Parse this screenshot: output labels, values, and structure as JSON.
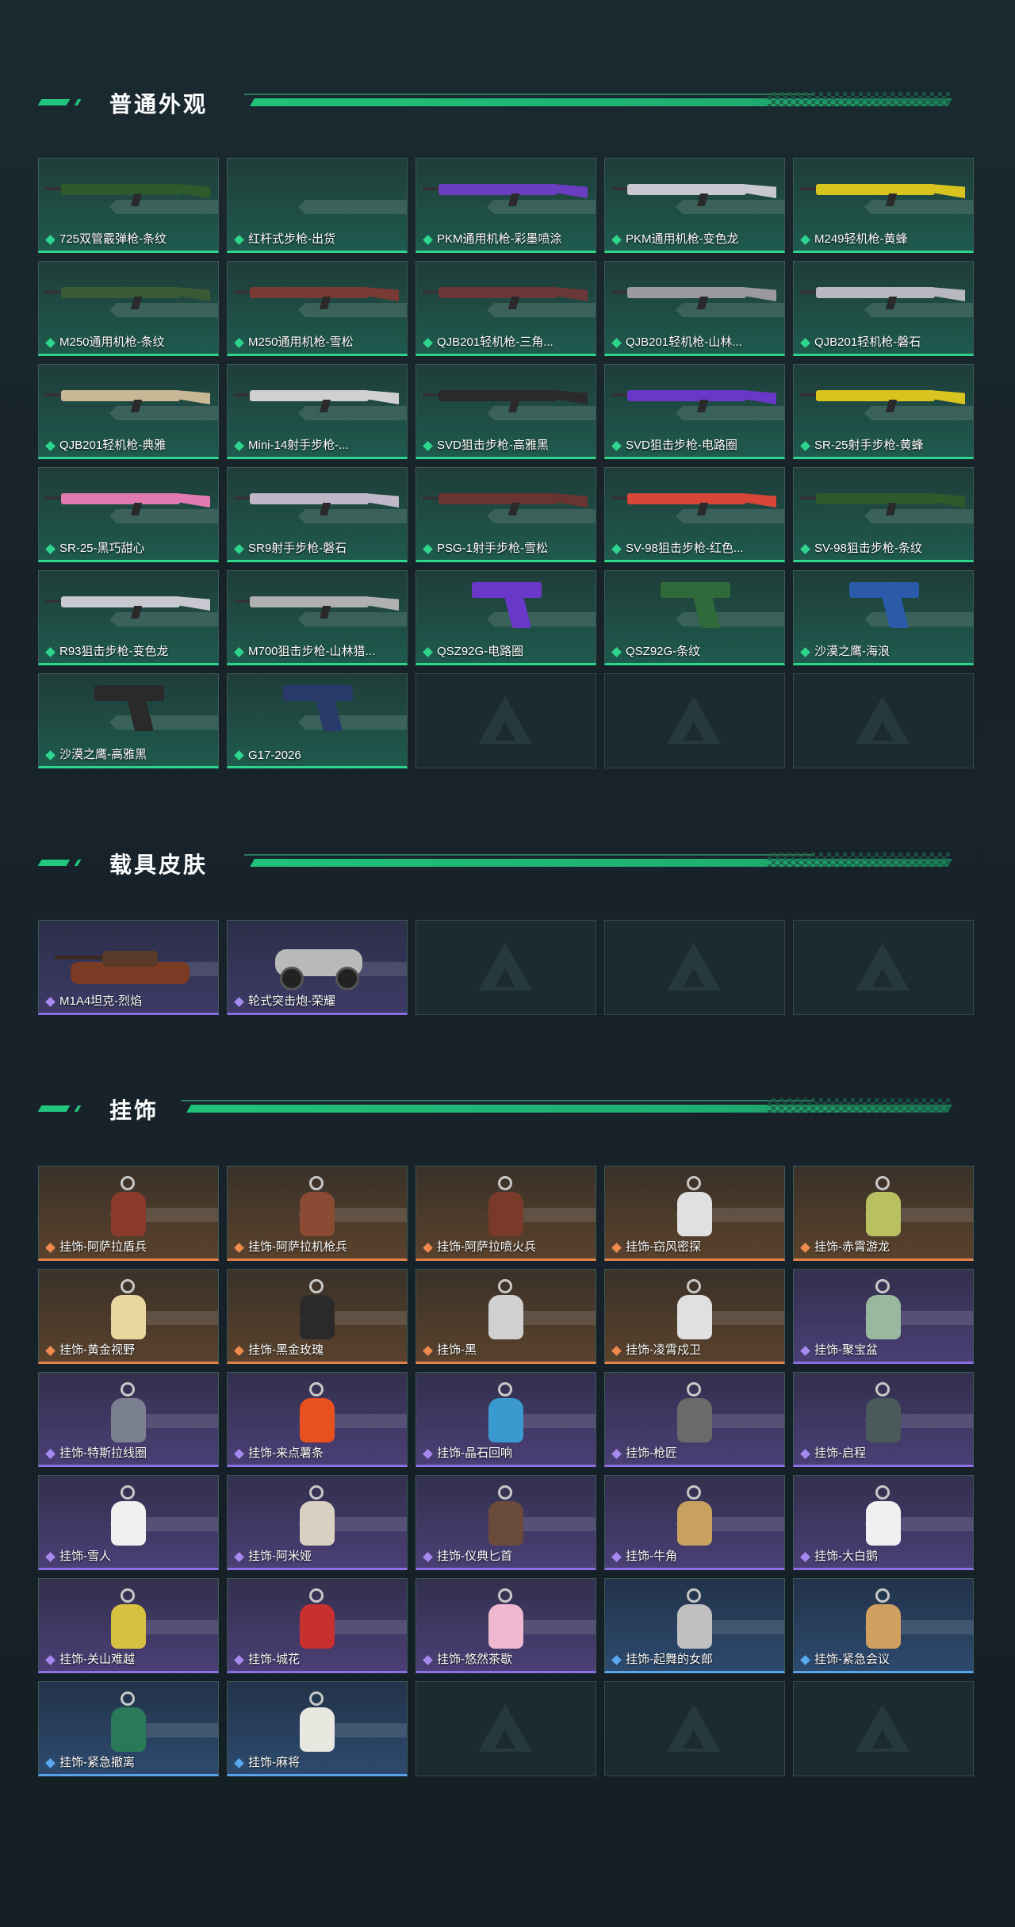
{
  "sections": [
    {
      "title": "普通外观",
      "items": [
        {
          "name": "725双管霰弹枪-条纹",
          "rarity": "weapon",
          "art": "gun",
          "color": "#2f5a2c"
        },
        {
          "name": "红杆式步枪-出货",
          "rarity": "weapon",
          "art": "none",
          "color": ""
        },
        {
          "name": "PKM通用机枪-彩墨喷涂",
          "rarity": "weapon",
          "art": "gun",
          "color": "#6a3ec0"
        },
        {
          "name": "PKM通用机枪-变色龙",
          "rarity": "weapon",
          "art": "gun",
          "color": "#c8c8d0"
        },
        {
          "name": "M249轻机枪-黄蜂",
          "rarity": "weapon",
          "art": "gun",
          "color": "#d8c41e"
        },
        {
          "name": "M250通用机枪-条纹",
          "rarity": "weapon",
          "art": "gun",
          "color": "#3a5a36"
        },
        {
          "name": "M250通用机枪-雪松",
          "rarity": "weapon",
          "art": "gun",
          "color": "#7a3a34"
        },
        {
          "name": "QJB201轻机枪-三角...",
          "rarity": "weapon",
          "art": "gun",
          "color": "#6a3838"
        },
        {
          "name": "QJB201轻机枪-山林...",
          "rarity": "weapon",
          "art": "gun",
          "color": "#9a9aa0"
        },
        {
          "name": "QJB201轻机枪-磐石",
          "rarity": "weapon",
          "art": "gun",
          "color": "#b8b8c0"
        },
        {
          "name": "QJB201轻机枪-典雅",
          "rarity": "weapon",
          "art": "gun",
          "color": "#c9b896"
        },
        {
          "name": "Mini-14射手步枪-...",
          "rarity": "weapon",
          "art": "gun",
          "color": "#d0d0d0"
        },
        {
          "name": "SVD狙击步枪-高雅黑",
          "rarity": "weapon",
          "art": "gun",
          "color": "#2a2a2a"
        },
        {
          "name": "SVD狙击步枪-电路圈",
          "rarity": "weapon",
          "art": "gun",
          "color": "#6a38c8"
        },
        {
          "name": "SR-25射手步枪-黄蜂",
          "rarity": "weapon",
          "art": "gun",
          "color": "#d8c41e"
        },
        {
          "name": "SR-25-黑巧甜心",
          "rarity": "weapon",
          "art": "gun",
          "color": "#e07ab0"
        },
        {
          "name": "SR9射手步枪-磐石",
          "rarity": "weapon",
          "art": "gun",
          "color": "#c0b8c8"
        },
        {
          "name": "PSG-1射手步枪-雪松",
          "rarity": "weapon",
          "art": "gun",
          "color": "#6a3432"
        },
        {
          "name": "SV-98狙击步枪-红色...",
          "rarity": "weapon",
          "art": "gun",
          "color": "#d8463a"
        },
        {
          "name": "SV-98狙击步枪-条纹",
          "rarity": "weapon",
          "art": "gun",
          "color": "#2f5a2c"
        },
        {
          "name": "R93狙击步枪-变色龙",
          "rarity": "weapon",
          "art": "gun",
          "color": "#c8c8d0"
        },
        {
          "name": "M700狙击步枪-山林猎...",
          "rarity": "weapon",
          "art": "gun",
          "color": "#b0b0b0"
        },
        {
          "name": "QSZ92G-电路圈",
          "rarity": "weapon",
          "art": "pistol",
          "color": "#6a38c8"
        },
        {
          "name": "QSZ92G-条纹",
          "rarity": "weapon",
          "art": "pistol",
          "color": "#2f6a3a"
        },
        {
          "name": "沙漠之鹰-海浪",
          "rarity": "weapon",
          "art": "pistol",
          "color": "#2a5aa8"
        },
        {
          "name": "沙漠之鹰-高雅黑",
          "rarity": "weapon",
          "art": "pistol",
          "color": "#2a2a2a"
        },
        {
          "name": "G17-2026",
          "rarity": "weapon",
          "art": "pistol",
          "color": "#2a3a6a"
        },
        {
          "name": "",
          "rarity": "empty",
          "art": "none",
          "color": ""
        },
        {
          "name": "",
          "rarity": "empty",
          "art": "none",
          "color": ""
        },
        {
          "name": "",
          "rarity": "empty",
          "art": "none",
          "color": ""
        }
      ]
    },
    {
      "title": "载具皮肤",
      "items": [
        {
          "name": "M1A4坦克-烈焰",
          "rarity": "vehicle",
          "art": "tank",
          "color": "#7a3a24"
        },
        {
          "name": "轮式突击炮-荣耀",
          "rarity": "vehicle",
          "art": "car",
          "color": "#b9b9b9"
        },
        {
          "name": "",
          "rarity": "empty",
          "art": "none",
          "color": ""
        },
        {
          "name": "",
          "rarity": "empty",
          "art": "none",
          "color": ""
        },
        {
          "name": "",
          "rarity": "empty",
          "art": "none",
          "color": ""
        }
      ]
    },
    {
      "title": "挂饰",
      "items": [
        {
          "name": "挂饰-阿萨拉盾兵",
          "rarity": "orange",
          "art": "charm",
          "color": "#8a3a2a"
        },
        {
          "name": "挂饰-阿萨拉机枪兵",
          "rarity": "orange",
          "art": "charm",
          "color": "#8a4a34"
        },
        {
          "name": "挂饰-阿萨拉喷火兵",
          "rarity": "orange",
          "art": "charm",
          "color": "#7a3a2a"
        },
        {
          "name": "挂饰-窃风密探",
          "rarity": "orange",
          "art": "charm",
          "color": "#e0e0e0"
        },
        {
          "name": "挂饰-赤霄游龙",
          "rarity": "orange",
          "art": "charm",
          "color": "#b8c060"
        },
        {
          "name": "挂饰-黄金视野",
          "rarity": "orange",
          "art": "charm",
          "color": "#e8d8a0"
        },
        {
          "name": "挂饰-黑金玫瑰",
          "rarity": "orange",
          "art": "charm",
          "color": "#2a2a2a"
        },
        {
          "name": "挂饰-黑",
          "rarity": "orange",
          "art": "charm",
          "color": "#d0d0d0"
        },
        {
          "name": "挂饰-凌霄戍卫",
          "rarity": "orange",
          "art": "charm",
          "color": "#e0e0e0"
        },
        {
          "name": "挂饰-聚宝盆",
          "rarity": "purple",
          "art": "charm",
          "color": "#9ab8a0"
        },
        {
          "name": "挂饰-特斯拉线圈",
          "rarity": "purple",
          "art": "charm",
          "color": "#7a8090"
        },
        {
          "name": "挂饰-来点薯条",
          "rarity": "purple",
          "art": "charm",
          "color": "#e85020"
        },
        {
          "name": "挂饰-晶石回响",
          "rarity": "purple",
          "art": "charm",
          "color": "#3a9ad0"
        },
        {
          "name": "挂饰-枪匠",
          "rarity": "purple",
          "art": "charm",
          "color": "#6a6a6a"
        },
        {
          "name": "挂饰-启程",
          "rarity": "purple",
          "art": "charm",
          "color": "#4a5a5a"
        },
        {
          "name": "挂饰-雪人",
          "rarity": "purple",
          "art": "charm",
          "color": "#f0f0f0"
        },
        {
          "name": "挂饰-阿米娅",
          "rarity": "purple",
          "art": "charm",
          "color": "#d8d0c0"
        },
        {
          "name": "挂饰-仪典匕首",
          "rarity": "purple",
          "art": "charm",
          "color": "#6a4a3a"
        },
        {
          "name": "挂饰-牛角",
          "rarity": "purple",
          "art": "charm",
          "color": "#c8a060"
        },
        {
          "name": "挂饰-大白鹅",
          "rarity": "purple",
          "art": "charm",
          "color": "#f0f0f0"
        },
        {
          "name": "挂饰-关山难越",
          "rarity": "purple",
          "art": "charm",
          "color": "#d8c040"
        },
        {
          "name": "挂饰-城花",
          "rarity": "purple",
          "art": "charm",
          "color": "#c83030"
        },
        {
          "name": "挂饰-悠然茶歇",
          "rarity": "purple",
          "art": "charm",
          "color": "#f0b8d0"
        },
        {
          "name": "挂饰-起舞的女郎",
          "rarity": "blue",
          "art": "charm",
          "color": "#c0c0c0"
        },
        {
          "name": "挂饰-紧急会议",
          "rarity": "blue",
          "art": "charm",
          "color": "#d0a060"
        },
        {
          "name": "挂饰-紧急撤离",
          "rarity": "blue",
          "art": "charm",
          "color": "#2a7a5a"
        },
        {
          "name": "挂饰-麻将",
          "rarity": "blue",
          "art": "charm",
          "color": "#e8e8e0"
        },
        {
          "name": "",
          "rarity": "empty",
          "art": "none",
          "color": ""
        },
        {
          "name": "",
          "rarity": "empty",
          "art": "none",
          "color": ""
        },
        {
          "name": "",
          "rarity": "empty",
          "art": "none",
          "color": ""
        }
      ]
    }
  ]
}
